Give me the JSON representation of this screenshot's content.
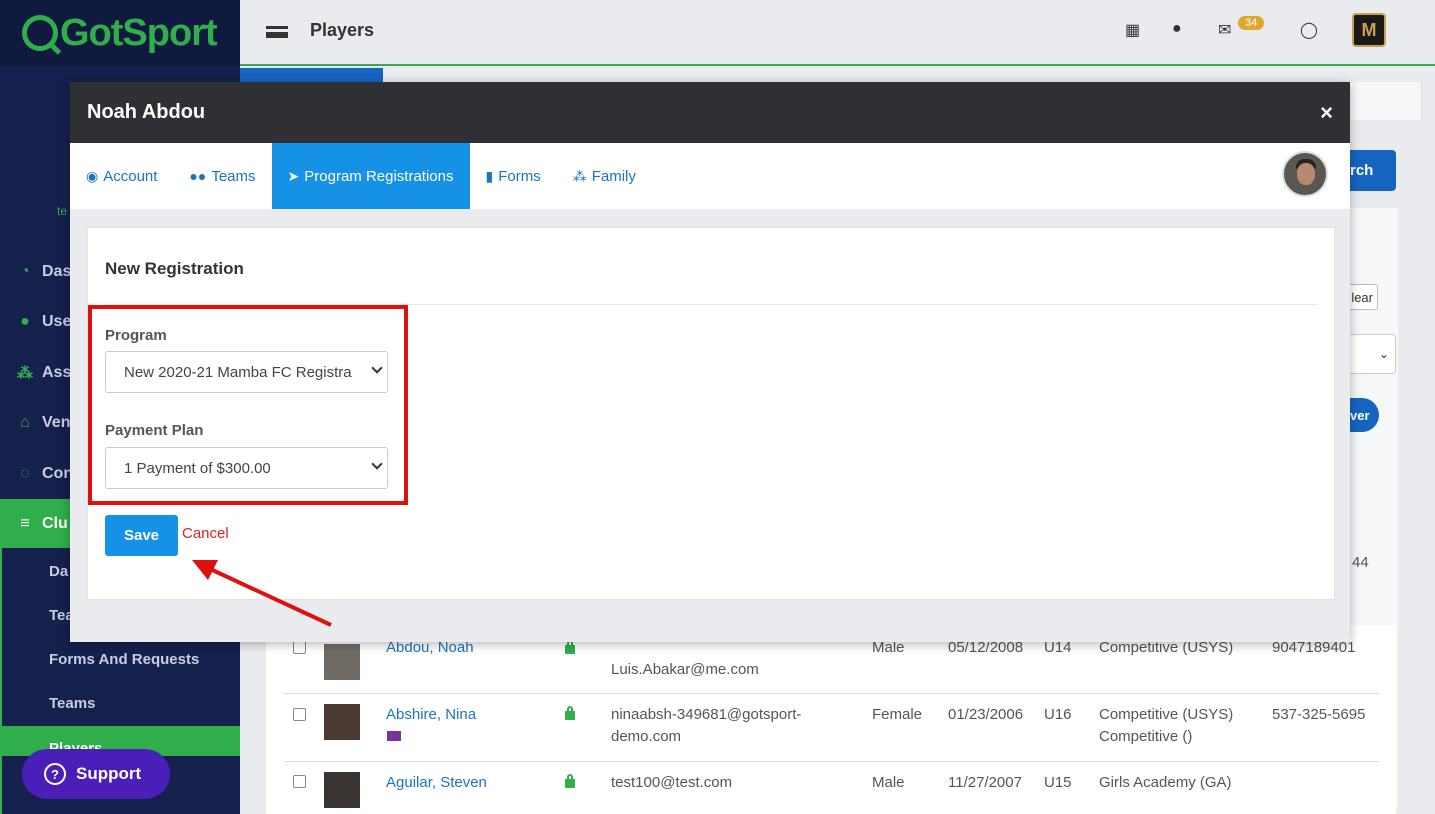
{
  "app": {
    "brand": "GotSport",
    "page_title": "Players",
    "mail_count": "34",
    "avatar_letter": "M"
  },
  "sidebar": {
    "hint": "te",
    "items": [
      {
        "label": "Das",
        "icon": "dashboard-icon"
      },
      {
        "label": "Use",
        "icon": "users-icon"
      },
      {
        "label": "Ass",
        "icon": "sitemap-icon"
      },
      {
        "label": "Ven",
        "icon": "home-icon"
      },
      {
        "label": "Con",
        "icon": "comments-icon"
      },
      {
        "label": "Clu",
        "icon": "list-icon"
      }
    ],
    "sub_items": [
      "Da",
      "Tea",
      "Forms And Requests",
      "Teams",
      "Players"
    ],
    "support_label": "Support"
  },
  "background": {
    "search_btn": "rch",
    "clear_btn": "lear",
    "select_hint": "",
    "player_btn": "ver",
    "partial_phone": "44"
  },
  "table": {
    "rows": [
      {
        "name": "Abdou, Noah",
        "email": "Luis.Abakar@me.com",
        "gender": "Male",
        "dob": "05/12/2008",
        "age": "U14",
        "program": "Competitive (USYS)",
        "program2": "",
        "phone": "9047189401"
      },
      {
        "name": "Abshire, Nina",
        "email": "ninaabsh-349681@gotsport-",
        "email2": "demo.com",
        "gender": "Female",
        "dob": "01/23/2006",
        "age": "U16",
        "program": "Competitive (USYS)",
        "program2": "Competitive ()",
        "phone": "537-325-5695"
      },
      {
        "name": "Aguilar, Steven",
        "email": "test100@test.com",
        "gender": "Male",
        "dob": "11/27/2007",
        "age": "U15",
        "program": "Girls Academy (GA)",
        "program2": "",
        "phone": ""
      }
    ]
  },
  "modal": {
    "title": "Noah Abdou",
    "close": "×",
    "tabs": [
      {
        "label": "Account",
        "icon": "user-circle-icon"
      },
      {
        "label": "Teams",
        "icon": "users-icon"
      },
      {
        "label": "Program Registrations",
        "icon": "paper-plane-icon"
      },
      {
        "label": "Forms",
        "icon": "file-icon"
      },
      {
        "label": "Family",
        "icon": "sitemap-icon"
      }
    ],
    "active_tab": "Program Registrations",
    "section_title": "New Registration",
    "program_label": "Program",
    "program_value": "New 2020-21 Mamba FC Registra",
    "payment_label": "Payment Plan",
    "payment_value": "1 Payment of $300.00",
    "save_label": "Save",
    "cancel_label": "Cancel"
  },
  "colors": {
    "brand_green": "#2fae4b",
    "sidebar_bg": "#16204d",
    "tab_active": "#1591e6",
    "highlight_red": "#e01010"
  }
}
